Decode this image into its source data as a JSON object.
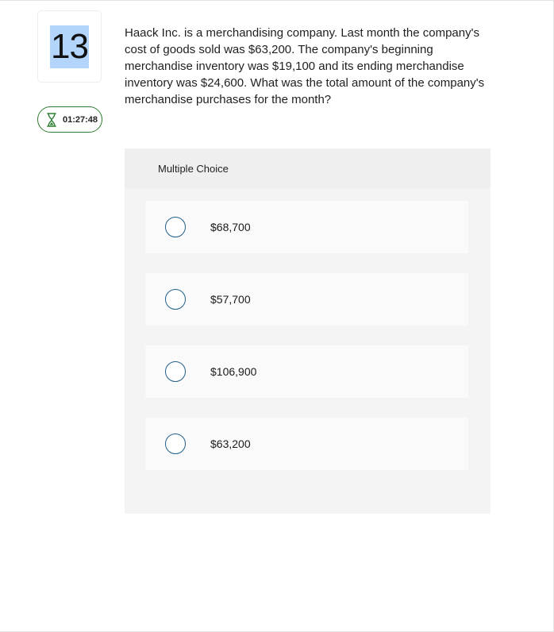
{
  "question_number": "13",
  "timer": {
    "icon": "hourglass-icon",
    "time": "01:27:48",
    "color": "#2e7d32"
  },
  "question_text": "Haack Inc. is a merchandising company. Last month the company's cost of goods sold was $63,200. The company's beginning merchandise inventory was $19,100 and its ending merchandise inventory was $24,600. What was the total amount of the company's merchandise purchases for the month?",
  "multiple_choice": {
    "header": "Multiple Choice",
    "options": [
      {
        "label": "$68,700",
        "selected": false
      },
      {
        "label": "$57,700",
        "selected": false
      },
      {
        "label": "$106,900",
        "selected": false
      },
      {
        "label": "$63,200",
        "selected": false
      }
    ]
  },
  "colors": {
    "radio_border": "#1f5f8b",
    "selection_highlight": "#b3d4fb"
  }
}
